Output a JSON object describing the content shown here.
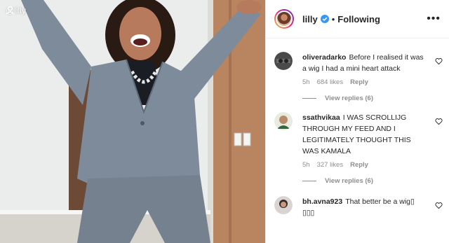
{
  "media": {
    "watermark": "@lilly"
  },
  "header": {
    "username": "lilly",
    "separator": "•",
    "follow_status": "Following",
    "more_label": "•••"
  },
  "comments": [
    {
      "username": "oliveradarko",
      "text": "Before I realised it was a wig I had a mini heart attack",
      "time": "5h",
      "likes": "684 likes",
      "reply_label": "Reply",
      "view_replies": "View replies (6)"
    },
    {
      "username": "ssathvikaa",
      "text": "I WAS SCROLLIJG THROUGH MY FEED AND I LEGITIMATELY THOUGHT THIS WAS KAMALA",
      "time": "5h",
      "likes": "327 likes",
      "reply_label": "Reply",
      "view_replies": "View replies (6)"
    },
    {
      "username": "bh.avna923",
      "text": "That better be a wig▯ ▯▯▯"
    }
  ],
  "colors": {
    "suit": "#7e8b9a",
    "verified": "#3897f0",
    "muted": "#8e8e8e"
  }
}
